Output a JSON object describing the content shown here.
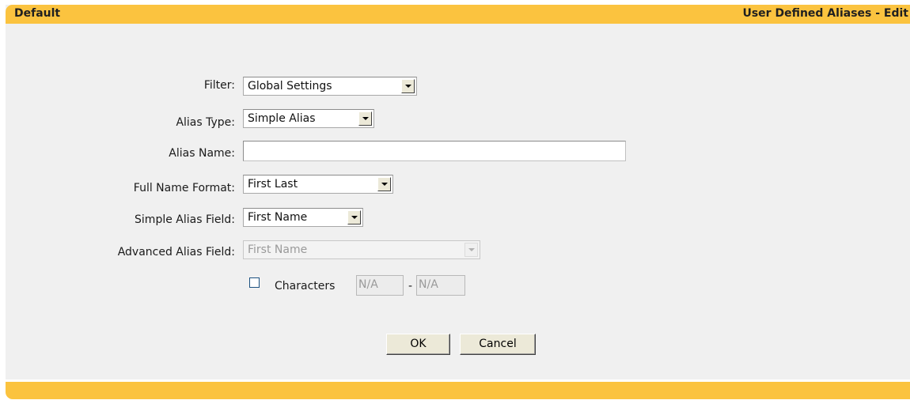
{
  "header": {
    "left_title": "Default",
    "right_title": "User Defined Aliases - Edit"
  },
  "form": {
    "filter": {
      "label": "Filter:",
      "value": "Global Settings"
    },
    "alias_type": {
      "label": "Alias Type:",
      "value": "Simple Alias"
    },
    "alias_name": {
      "label": "Alias Name:",
      "value": ""
    },
    "full_name_format": {
      "label": "Full Name Format:",
      "value": "First Last"
    },
    "simple_alias_field": {
      "label": "Simple Alias Field:",
      "value": "First Name"
    },
    "advanced_alias_field": {
      "label": "Advanced Alias Field:",
      "value": "First Name",
      "disabled": true
    },
    "characters": {
      "label": "Characters",
      "checked": false,
      "from_value": "N/A",
      "separator": "-",
      "to_value": "N/A"
    }
  },
  "buttons": {
    "ok_label": "OK",
    "cancel_label": "Cancel"
  },
  "colors": {
    "accent_bar": "#fbc33f",
    "panel_background": "#f0f0f0"
  }
}
